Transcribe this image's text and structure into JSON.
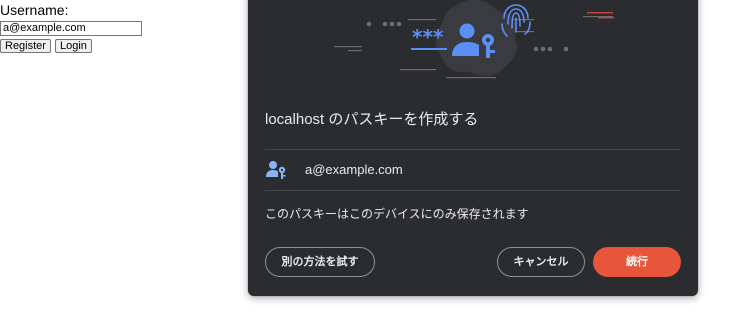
{
  "page": {
    "username_label": "Username:",
    "username_value": "a@example.com",
    "register_label": "Register",
    "login_label": "Login"
  },
  "dialog": {
    "title": "localhost のパスキーを作成する",
    "account_email": "a@example.com",
    "storage_note": "このパスキーはこのデバイスにのみ保存されます",
    "buttons": {
      "other_method": "別の方法を試す",
      "cancel": "キャンセル",
      "continue": "続行"
    },
    "illustration_icons": [
      "passkey-icon",
      "fingerprint-icon",
      "password-asterisks-icon"
    ]
  },
  "colors": {
    "dialog_bg": "#2b2c30",
    "accent_blue": "#5b8ff5",
    "continue_button": "#e7553a",
    "text": "#e8eaed"
  }
}
